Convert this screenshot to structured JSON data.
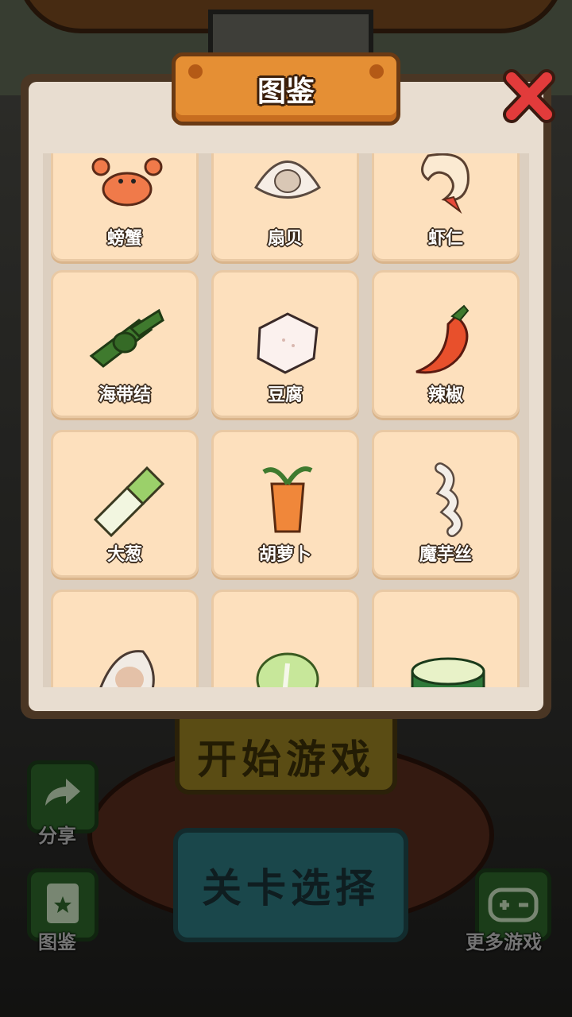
{
  "modal": {
    "title": "图鉴",
    "close_icon": "close-x-icon",
    "items": [
      {
        "label": "螃蟹",
        "icon": "crab-icon"
      },
      {
        "label": "扇贝",
        "icon": "scallop-icon"
      },
      {
        "label": "虾仁",
        "icon": "shrimp-icon"
      },
      {
        "label": "海带结",
        "icon": "kelp-knot-icon"
      },
      {
        "label": "豆腐",
        "icon": "tofu-icon"
      },
      {
        "label": "辣椒",
        "icon": "chili-icon"
      },
      {
        "label": "大葱",
        "icon": "scallion-icon"
      },
      {
        "label": "胡萝卜",
        "icon": "carrot-icon"
      },
      {
        "label": "魔芋丝",
        "icon": "konjac-noodle-icon"
      },
      {
        "label": "",
        "icon": "oyster-icon"
      },
      {
        "label": "",
        "icon": "cabbage-icon"
      },
      {
        "label": "",
        "icon": "cucumber-icon"
      }
    ]
  },
  "background": {
    "start_button": "开始游戏",
    "level_button": "关卡选择",
    "share_label": "分享",
    "gallery_label": "图鉴",
    "more_games_label": "更多游戏"
  },
  "colors": {
    "plaque": "#e58f34",
    "cell": "#fde0bd",
    "close": "#e23b3b"
  }
}
